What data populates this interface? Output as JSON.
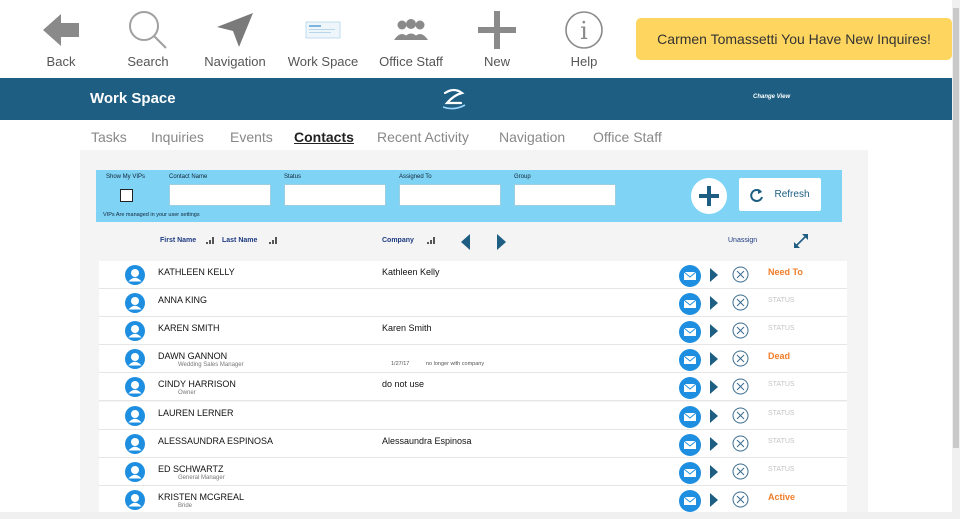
{
  "toolbar": {
    "items": [
      {
        "label": "Back",
        "icon": "back-arrow-icon"
      },
      {
        "label": "Search",
        "icon": "search-icon"
      },
      {
        "label": "Navigation",
        "icon": "navigation-arrow-icon"
      },
      {
        "label": "Work Space",
        "icon": "workspace-icon"
      },
      {
        "label": "Office Staff",
        "icon": "people-icon"
      },
      {
        "label": "New",
        "icon": "plus-icon"
      },
      {
        "label": "Help",
        "icon": "info-icon"
      }
    ],
    "alert": "Carmen Tomassetti You Have New Inquires!"
  },
  "header": {
    "title": "Work Space",
    "change_view": "Change View"
  },
  "tabs": [
    "Tasks",
    "Inquiries",
    "Events",
    "Contacts",
    "Recent Activity",
    "Navigation",
    "Office Staff"
  ],
  "active_tab": "Contacts",
  "filter": {
    "show_vips": "Show My VIPs",
    "contact_name": "Contact Name",
    "status": "Status",
    "assigned_to": "Assigned To",
    "group": "Group",
    "vip_note": "VIPs Are managed in your user settings",
    "refresh": "Refresh"
  },
  "columns": {
    "first_name": "First Name",
    "last_name": "Last Name",
    "company": "Company",
    "unassign": "Unassign"
  },
  "contacts": [
    {
      "name": "KATHLEEN KELLY",
      "sub": "",
      "company": "Kathleen Kelly",
      "date": "",
      "note": "",
      "status": "Need To"
    },
    {
      "name": "ANNA KING",
      "sub": "",
      "company": "",
      "date": "",
      "note": "",
      "status": "STATUS"
    },
    {
      "name": "KAREN SMITH",
      "sub": "",
      "company": "Karen Smith",
      "date": "",
      "note": "",
      "status": "STATUS"
    },
    {
      "name": "DAWN GANNON",
      "sub": "Wedding Sales Manager",
      "company": "",
      "date": "1/27/17",
      "note": "no longer with company",
      "status": "Dead"
    },
    {
      "name": "CINDY HARRISON",
      "sub": "Owner",
      "company": "do not use",
      "date": "",
      "note": "",
      "status": "STATUS"
    },
    {
      "name": "LAUREN LERNER",
      "sub": "",
      "company": "",
      "date": "",
      "note": "",
      "status": "STATUS"
    },
    {
      "name": "ALESSAUNDRA ESPINOSA",
      "sub": "",
      "company": "Alessaundra Espinosa",
      "date": "",
      "note": "",
      "status": "STATUS"
    },
    {
      "name": "ED SCHWARTZ",
      "sub": "General Manager",
      "company": "",
      "date": "",
      "note": "",
      "status": "STATUS"
    },
    {
      "name": "KRISTEN MCGREAL",
      "sub": "Bride",
      "company": "",
      "date": "",
      "note": "",
      "status": "Active"
    }
  ],
  "colors": {
    "header_bar": "#1d5e82",
    "filter_bg": "#7fd4f6",
    "alert_bg": "#fed55f",
    "status_hot": "#f07d2a",
    "mail_blue": "#1e8fe0",
    "nav_blue": "#1d5e82"
  }
}
